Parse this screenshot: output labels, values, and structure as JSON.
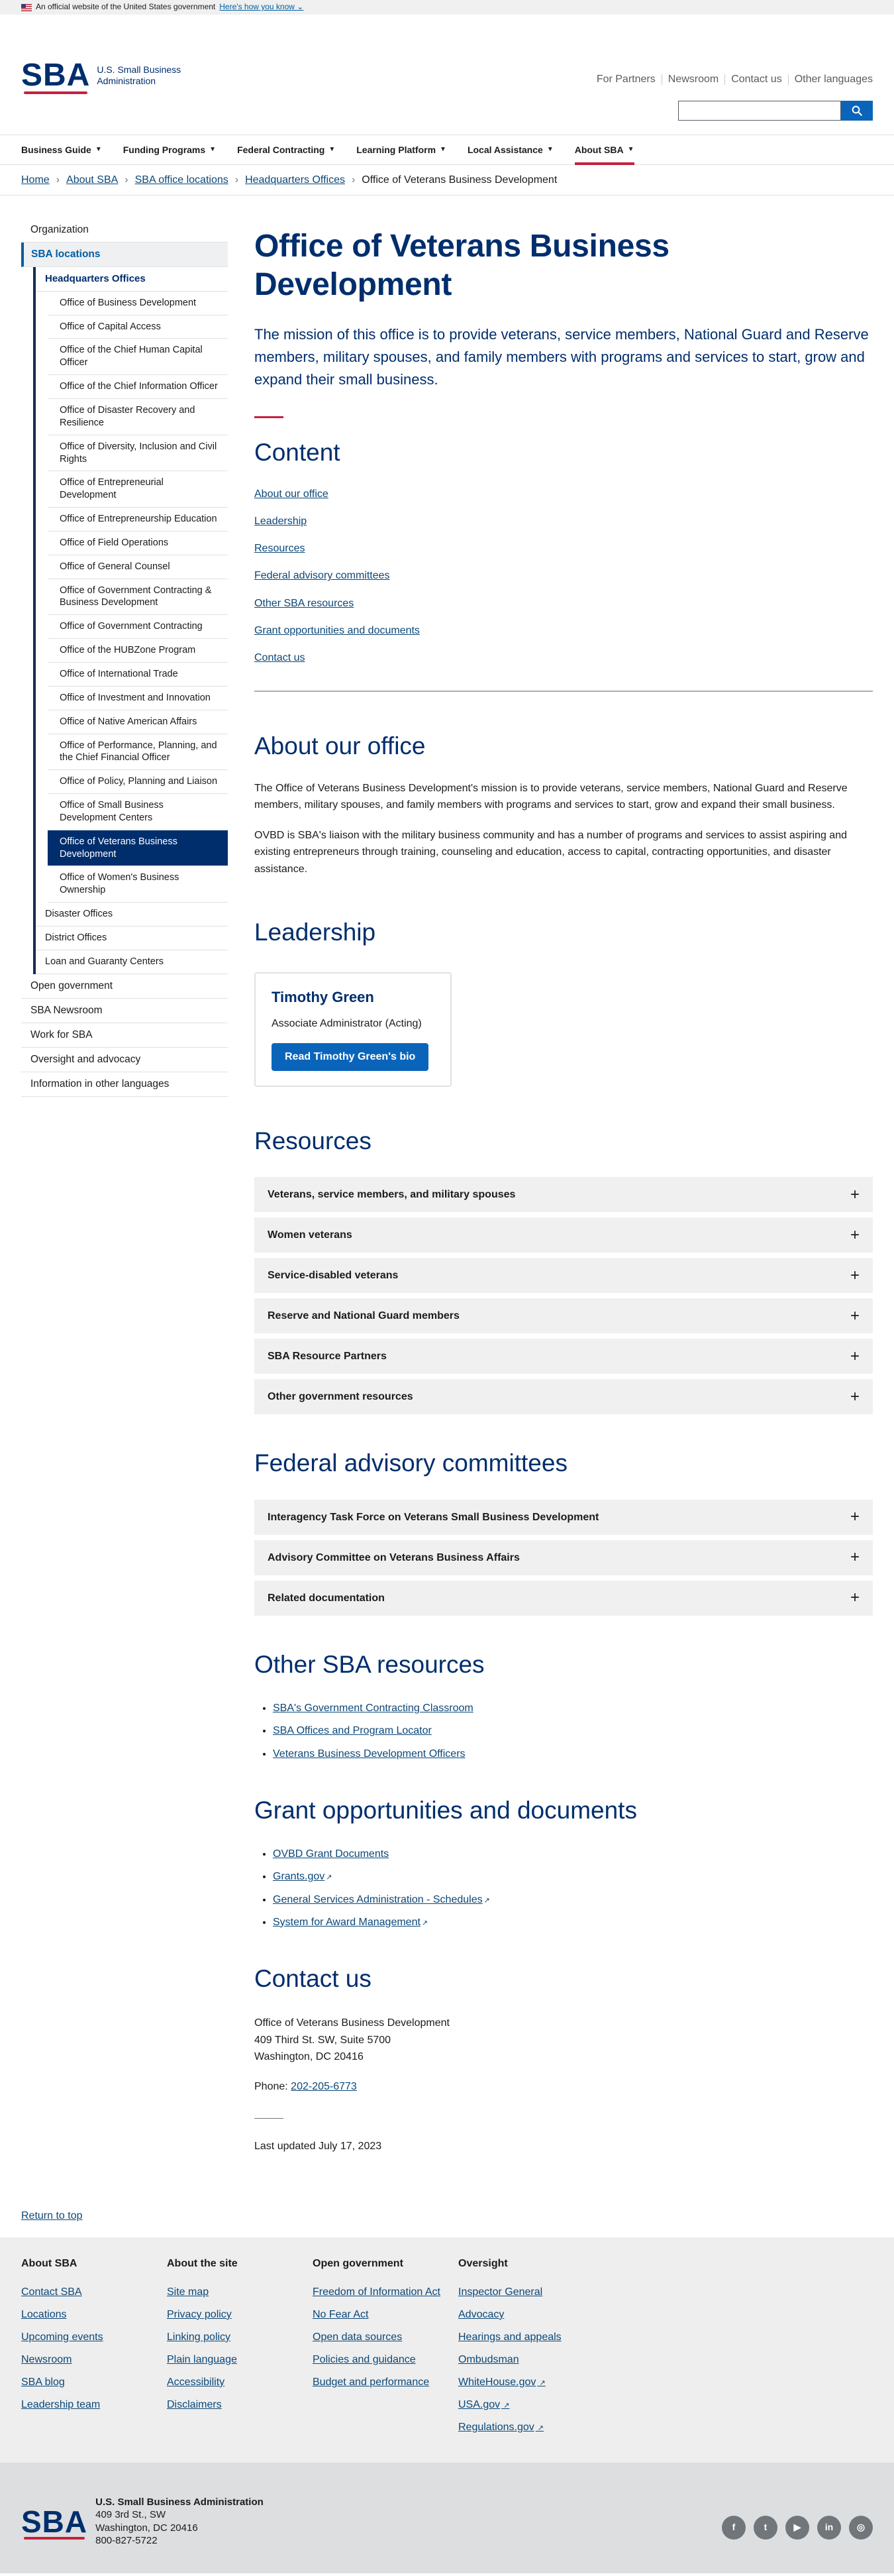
{
  "gov_banner": {
    "text": "An official website of the United States government",
    "link": "Here's how you know"
  },
  "header": {
    "logo_mark": "SBA",
    "logo_line1": "U.S. Small Business",
    "logo_line2": "Administration",
    "util_links": [
      "For Partners",
      "Newsroom",
      "Contact us",
      "Other languages"
    ],
    "search_placeholder": ""
  },
  "nav": {
    "items": [
      "Business Guide",
      "Funding Programs",
      "Federal Contracting",
      "Learning Platform",
      "Local Assistance",
      "About SBA"
    ],
    "active_index": 5
  },
  "breadcrumb": [
    "Home",
    "About SBA",
    "SBA office locations",
    "Headquarters Offices",
    "Office of Veterans Business Development"
  ],
  "sidenav": {
    "top": [
      "Organization",
      "SBA locations"
    ],
    "hq_head": "Headquarters Offices",
    "hq_items": [
      "Office of Business Development",
      "Office of Capital Access",
      "Office of the Chief Human Capital Officer",
      "Office of the Chief Information Officer",
      "Office of Disaster Recovery and Resilience",
      "Office of Diversity, Inclusion and Civil Rights",
      "Office of Entrepreneurial Development",
      "Office of Entrepreneurship Education",
      "Office of Field Operations",
      "Office of General Counsel",
      "Office of Government Contracting & Business Development",
      "Office of Government Contracting",
      "Office of the HUBZone Program",
      "Office of International Trade",
      "Office of Investment and Innovation",
      "Office of Native American Affairs",
      "Office of Performance, Planning, and the Chief Financial Officer",
      "Office of Policy, Planning and Liaison",
      "Office of Small Business Development Centers",
      "Office of Veterans Business Development",
      "Office of Women's Business Ownership"
    ],
    "current_index": 19,
    "loc_items": [
      "Disaster Offices",
      "District Offices",
      "Loan and Guaranty Centers"
    ],
    "bottom": [
      "Open government",
      "SBA Newsroom",
      "Work for SBA",
      "Oversight and advocacy",
      "Information in other languages"
    ]
  },
  "page": {
    "title": "Office of Veterans Business Development",
    "lead": "The mission of this office is to provide veterans, service members, National Guard and Reserve members, military spouses, and family members with programs and services to start, grow and expand their small business.",
    "toc_title": "Content",
    "toc": [
      "About our office",
      "Leadership",
      "Resources",
      "Federal advisory committees",
      "Other SBA resources",
      "Grant opportunities and documents",
      "Contact us"
    ],
    "about_title": "About our office",
    "about_p1": "The Office of Veterans Business Development's mission is to provide veterans, service members, National Guard and Reserve members, military spouses, and family members with programs and services to start, grow and expand their small business.",
    "about_p2": "OVBD is SBA's liaison with the military business community and has a number of programs and services to assist aspiring and existing entrepreneurs through training, counseling and education, access to capital, contracting opportunities, and disaster assistance.",
    "leadership_title": "Leadership",
    "leader": {
      "name": "Timothy Green",
      "role": "Associate Administrator (Acting)",
      "button": "Read Timothy Green's bio"
    },
    "resources_title": "Resources",
    "resources": [
      "Veterans, service members, and military spouses",
      "Women veterans",
      "Service-disabled veterans",
      "Reserve and National Guard members",
      "SBA Resource Partners",
      "Other government resources"
    ],
    "committees_title": "Federal advisory committees",
    "committees": [
      "Interagency Task Force on Veterans Small Business Development",
      "Advisory Committee on Veterans Business Affairs",
      "Related documentation"
    ],
    "other_title": "Other SBA resources",
    "other_links": [
      "SBA's Government Contracting Classroom",
      "SBA Offices and Program Locator",
      "Veterans Business Development Officers"
    ],
    "grants_title": "Grant opportunities and documents",
    "grant_links": [
      "OVBD Grant Documents",
      "Grants.gov",
      "General Services Administration - Schedules",
      "System for Award Management"
    ],
    "contact_title": "Contact us",
    "address_line1": "Office of Veterans Business Development",
    "address_line2": "409 Third St. SW, Suite 5700",
    "address_line3": "Washington, DC 20416",
    "phone_label": "Phone:",
    "phone": "202-205-6773",
    "updated": "Last updated July 17, 2023"
  },
  "return_top": "Return to top",
  "footer": {
    "columns": [
      {
        "title": "About SBA",
        "links": [
          "Contact SBA",
          "Locations",
          "Upcoming events",
          "Newsroom",
          "SBA blog",
          "Leadership team"
        ]
      },
      {
        "title": "About the site",
        "links": [
          "Site map",
          "Privacy policy",
          "Linking policy",
          "Plain language",
          "Accessibility",
          "Disclaimers"
        ]
      },
      {
        "title": "Open government",
        "links": [
          "Freedom of Information Act",
          "No Fear Act",
          "Open data sources",
          "Policies and guidance",
          "Budget and performance"
        ]
      },
      {
        "title": "Oversight",
        "links": [
          "Inspector General",
          "Advocacy",
          "Hearings and appeals",
          "Ombudsman",
          "WhiteHouse.gov",
          "USA.gov",
          "Regulations.gov"
        ]
      }
    ]
  },
  "bottom": {
    "agency_name": "U.S. Small Business Administration",
    "addr1": "409 3rd St., SW",
    "addr2": "Washington, DC 20416",
    "phone": "800-827-5722",
    "social_icons": [
      "facebook-icon",
      "twitter-icon",
      "youtube-icon",
      "linkedin-icon",
      "instagram-icon"
    ]
  },
  "colors": {
    "navy": "#002e6d",
    "accent_red": "#c5203e",
    "link": "#0b4778",
    "button": "#0a65ba"
  }
}
